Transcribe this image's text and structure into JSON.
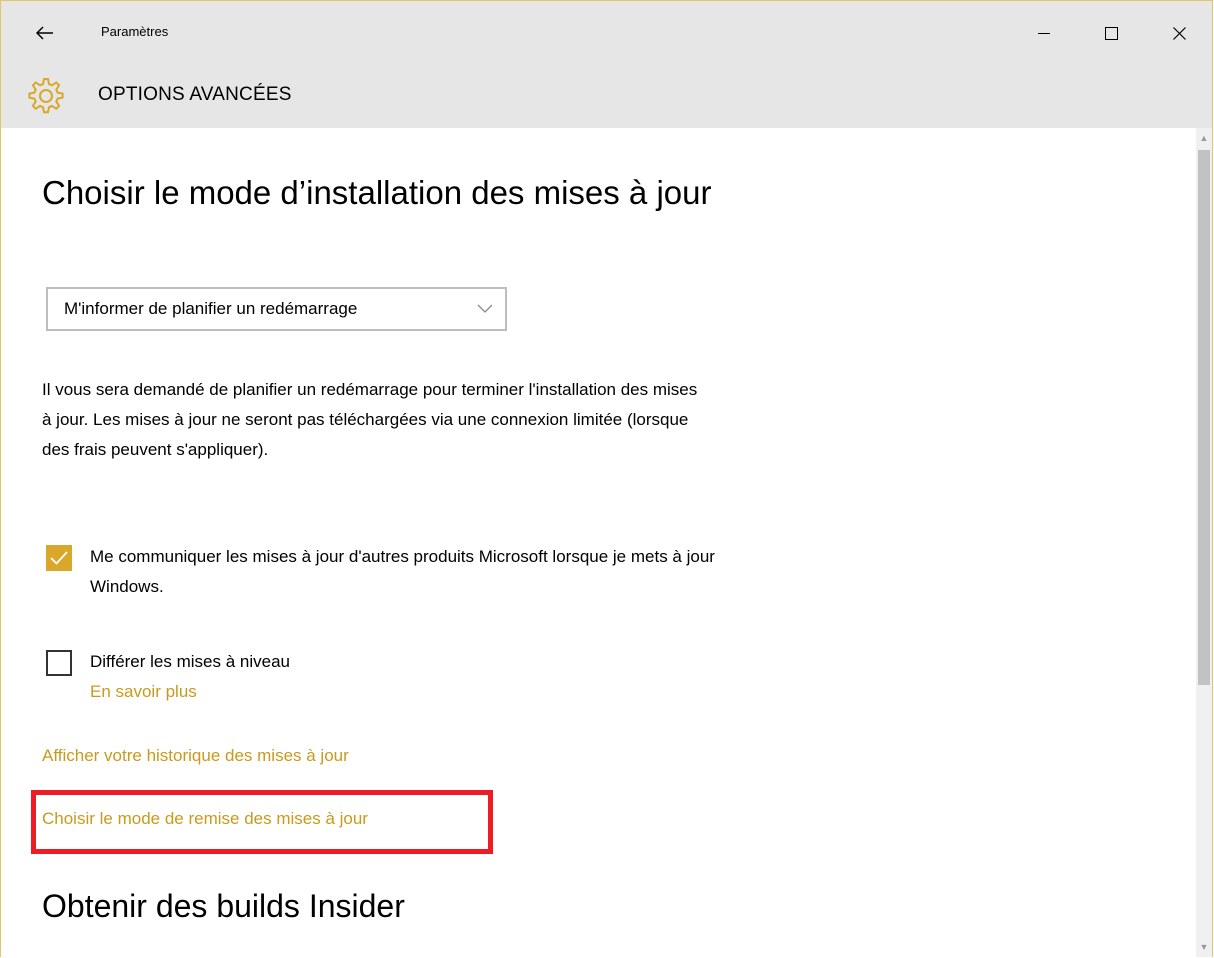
{
  "window": {
    "app_title": "Paramètres",
    "accent_color": "#d9a82a",
    "link_color": "#c99a1c",
    "highlight_color": "#ee1c25"
  },
  "titlebar": {
    "back_icon": "arrow-left-icon",
    "minimize_icon": "minimize-icon",
    "maximize_icon": "maximize-icon",
    "close_icon": "close-icon"
  },
  "header": {
    "icon": "gear-icon",
    "title": "OPTIONS AVANCÉES"
  },
  "main": {
    "section_title": "Choisir le mode d’installation des mises à jour",
    "install_mode_dropdown": {
      "selected": "M'informer de planifier un redémarrage"
    },
    "description": "Il vous sera demandé de planifier un redémarrage pour terminer l'installation des mises à jour. Les mises à jour ne seront pas téléchargées via une connexion limitée (lorsque des frais peuvent s'appliquer).",
    "microsoft_updates_checkbox": {
      "checked": true,
      "label": "Me communiquer les mises à jour d'autres produits Microsoft lorsque je mets à jour Windows."
    },
    "defer_upgrades_checkbox": {
      "checked": false,
      "label": "Différer les mises à niveau",
      "learn_more": "En savoir plus"
    },
    "history_link": "Afficher votre historique des mises à jour",
    "delivery_link": "Choisir le mode de remise des mises à jour",
    "insider_title": "Obtenir des builds Insider"
  }
}
